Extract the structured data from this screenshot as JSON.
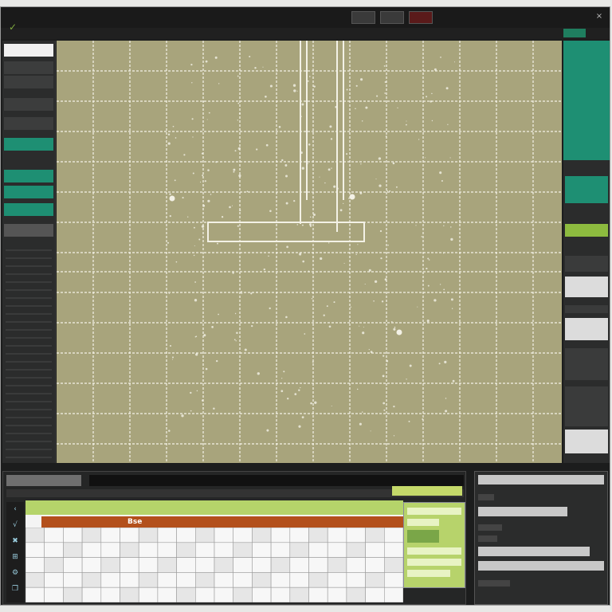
{
  "window": {
    "title": "",
    "close_glyph": "×"
  },
  "titlebar": {
    "tabs": [
      {
        "label": ""
      },
      {
        "label": ""
      },
      {
        "label": ""
      }
    ]
  },
  "toolbar": {
    "path": "",
    "status": "",
    "ok_label": ""
  },
  "left_panel": {
    "items": [
      "",
      "",
      "",
      "",
      "",
      "",
      "",
      "",
      ""
    ]
  },
  "right_panel": {
    "blocks": [
      "",
      "",
      "",
      "",
      "",
      "",
      "",
      "",
      ""
    ]
  },
  "bottom_left": {
    "header": "",
    "green_button": "",
    "sheet_label": "Bse",
    "tools": [
      "‹",
      "√",
      "✖",
      "⊞",
      "⚙",
      "❐"
    ]
  },
  "bottom_right": {
    "bars": [
      "",
      "",
      "",
      "",
      "",
      ""
    ]
  },
  "colors": {
    "canvas": "#a8a47c",
    "accent_teal": "#1e8f73",
    "accent_lime": "#8dbb3f",
    "sheet_header": "#b3501c",
    "grid_line": "#f3f1e6"
  }
}
